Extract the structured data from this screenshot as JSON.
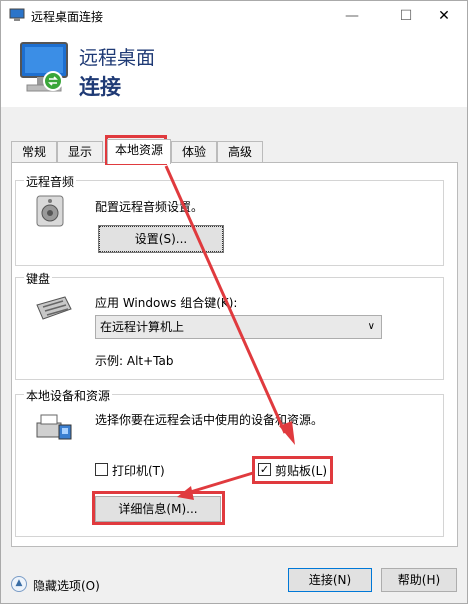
{
  "window": {
    "title": "远程桌面连接",
    "controls": {
      "minimize": "—",
      "maximize": "☐",
      "close": "✕"
    }
  },
  "header": {
    "line1": "远程桌面",
    "line2": "连接",
    "icon": "remote-desktop-computer-icon"
  },
  "tabs": [
    {
      "label": "常规"
    },
    {
      "label": "显示"
    },
    {
      "label": "本地资源",
      "active": true
    },
    {
      "label": "体验"
    },
    {
      "label": "高级"
    }
  ],
  "audio": {
    "title": "远程音频",
    "description": "配置远程音频设置。",
    "settings_button": "设置(S)...",
    "icon": "speaker-icon"
  },
  "keyboard": {
    "title": "键盘",
    "apply_label": "应用 Windows 组合键(K):",
    "selected_option": "在远程计算机上",
    "example": "示例: Alt+Tab",
    "icon": "keyboard-icon"
  },
  "devices": {
    "title": "本地设备和资源",
    "description": "选择你要在远程会话中使用的设备和资源。",
    "printer": {
      "label": "打印机(T)",
      "checked": false
    },
    "clipboard": {
      "label": "剪贴板(L)",
      "checked": true
    },
    "details_button": "详细信息(M)...",
    "icon": "printer-devices-icon"
  },
  "footer": {
    "hide_options": "隐藏选项(O)",
    "connect_button": "连接(N)",
    "help_button": "帮助(H)"
  },
  "colors": {
    "title_blue": "#1f3a75",
    "annotation_red": "#e03a3e",
    "primary_border": "#0078d7"
  }
}
